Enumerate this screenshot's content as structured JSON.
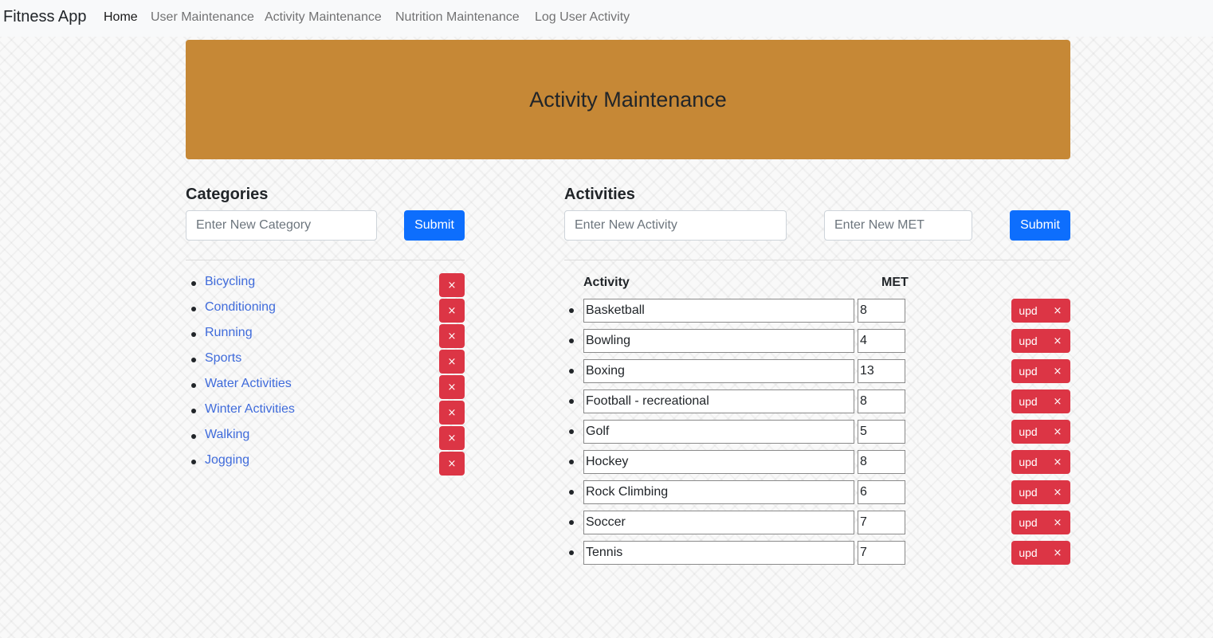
{
  "nav": {
    "brand": "Fitness App",
    "links": [
      "Home",
      "User Maintenance",
      "Activity Maintenance",
      "Nutrition Maintenance",
      "Log User Activity"
    ]
  },
  "banner": {
    "title": "Activity Maintenance"
  },
  "categories": {
    "title": "Categories",
    "input_placeholder": "Enter New Category",
    "submit_label": "Submit",
    "delete_label": "×",
    "items": [
      "Bicycling",
      "Conditioning",
      "Running",
      "Sports",
      "Water Activities",
      "Winter Activities",
      "Walking",
      "Jogging"
    ]
  },
  "activities": {
    "title": "Activities",
    "activity_placeholder": "Enter New Activity",
    "met_placeholder": "Enter New MET",
    "submit_label": "Submit",
    "col_activity": "Activity",
    "col_met": "MET",
    "update_label": "upd",
    "delete_label": "×",
    "items": [
      {
        "name": "Basketball",
        "met": "8"
      },
      {
        "name": "Bowling",
        "met": "4"
      },
      {
        "name": "Boxing",
        "met": "13"
      },
      {
        "name": "Football - recreational",
        "met": "8"
      },
      {
        "name": "Golf",
        "met": "5"
      },
      {
        "name": "Hockey",
        "met": "8"
      },
      {
        "name": "Rock Climbing",
        "met": "6"
      },
      {
        "name": "Soccer",
        "met": "7"
      },
      {
        "name": "Tennis",
        "met": "7"
      }
    ]
  },
  "colors": {
    "banner": "#c68836",
    "primary": "#0d6efd",
    "danger": "#dc3545",
    "link": "#3f6bdb"
  }
}
